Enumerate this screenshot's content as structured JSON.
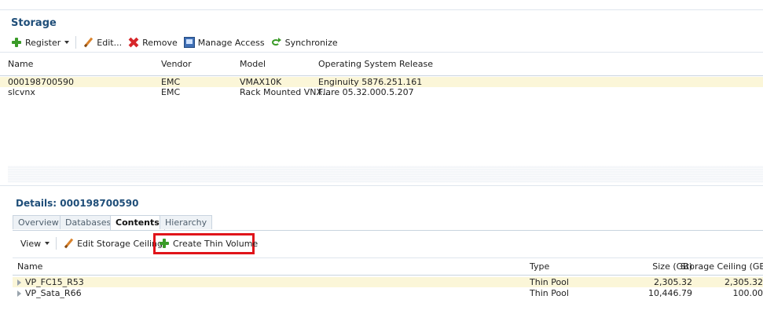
{
  "storage": {
    "title": "Storage",
    "toolbar": {
      "register": "Register",
      "edit": "Edit...",
      "remove": "Remove",
      "manage_access": "Manage Access",
      "synchronize": "Synchronize"
    },
    "columns": [
      "Name",
      "Vendor",
      "Model",
      "Operating System Release"
    ],
    "rows": [
      {
        "name": "000198700590",
        "vendor": "EMC",
        "model": "VMAX10K",
        "os": "Enginuity 5876.251.161"
      },
      {
        "name": "slcvnx",
        "vendor": "EMC",
        "model": "Rack Mounted VNX...",
        "os": "Flare 05.32.000.5.207"
      }
    ]
  },
  "details": {
    "title": "Details: 000198700590",
    "tabs": [
      "Overview",
      "Databases",
      "Contents",
      "Hierarchy"
    ],
    "active_tab": "Contents",
    "toolbar": {
      "view": "View",
      "edit_ceiling": "Edit Storage Ceiling",
      "create_thin": "Create Thin Volume"
    },
    "columns": [
      "Name",
      "Type",
      "Size (GB)",
      "Storage Ceiling (GB)"
    ],
    "rows": [
      {
        "name": "VP_FC15_R53",
        "type": "Thin Pool",
        "size": "2,305.32",
        "ceiling": "2,305.32"
      },
      {
        "name": "VP_Sata_R66",
        "type": "Thin Pool",
        "size": "10,446.79",
        "ceiling": "100.00"
      }
    ]
  },
  "colors": {
    "title": "#1f4e79",
    "selected_row": "#fbf6d8",
    "highlight": "#e0141a",
    "add_green": "#3a9b28",
    "remove_red": "#d7262a"
  }
}
